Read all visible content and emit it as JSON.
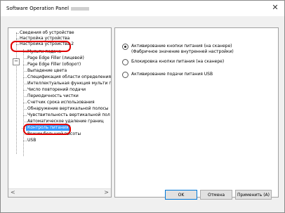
{
  "window": {
    "title": "Software Operation Panel",
    "close_glyph": "✕"
  },
  "tree": {
    "items": [
      {
        "label": "Сведения об устройстве",
        "level": 1
      },
      {
        "label": "Настройка устройства",
        "level": 1
      },
      {
        "label": "Настройка устройства 2",
        "level": 1
      },
      {
        "label": "Мульти подача",
        "level": 2
      },
      {
        "label": "Page Edge Filler (лицевой)",
        "level": 2
      },
      {
        "label": "Page Edge Filler (оборот)",
        "level": 2
      },
      {
        "label": "Выпадение цвета",
        "level": 2
      },
      {
        "label": "Спецификация области определения н",
        "level": 2
      },
      {
        "label": "Интеллектуальная функция мульти п",
        "level": 2
      },
      {
        "label": "Число повторений подачи",
        "level": 2
      },
      {
        "label": "Периодичность чистки",
        "level": 2
      },
      {
        "label": "Счетчик срока использования",
        "level": 2
      },
      {
        "label": "Обнаружение вертикальной полосы",
        "level": 2
      },
      {
        "label": "Чувствительность вертикальной пол",
        "level": 2
      },
      {
        "label": "Автоматическое удаление границ",
        "level": 2
      },
      {
        "label": "Контроль питания",
        "level": 2,
        "selected": true
      },
      {
        "label": "Режим большой высоты",
        "level": 2
      },
      {
        "label": "USB",
        "level": 2
      }
    ],
    "expander_glyph": "−",
    "scroll_left": "<",
    "scroll_right": ">"
  },
  "options": [
    {
      "line1": "Активирование кнопки питания (на сканере)",
      "line2": "(Фабричное значение внутренней настройки)",
      "checked": true
    },
    {
      "line1": "Блокировка кнопки питания (на сканере)",
      "line2": "",
      "checked": false
    },
    {
      "line1": "Активирование подачи питания USB",
      "line2": "",
      "checked": false
    }
  ],
  "buttons": {
    "ok": "OK",
    "cancel": "Отмена",
    "apply": "Применить (A)"
  },
  "colors": {
    "highlight": "#e00000",
    "selection": "#3399ff"
  }
}
